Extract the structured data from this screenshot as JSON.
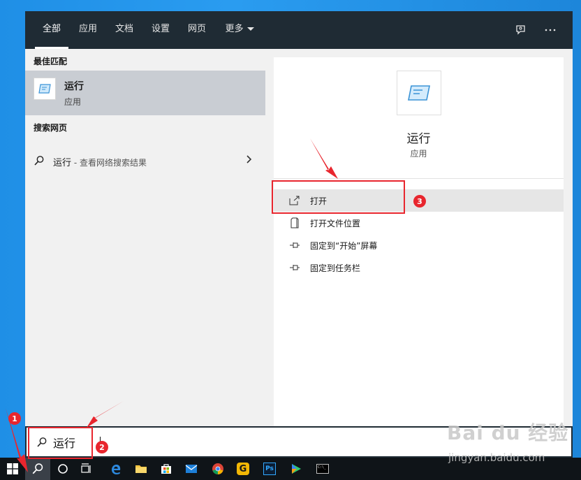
{
  "tabs": [
    {
      "label": "全部",
      "active": true
    },
    {
      "label": "应用"
    },
    {
      "label": "文档"
    },
    {
      "label": "设置"
    },
    {
      "label": "网页"
    },
    {
      "label": "更多"
    }
  ],
  "top_icons": [
    "feedback-icon",
    "more-icon"
  ],
  "left": {
    "best_match_title": "最佳匹配",
    "best_match": {
      "name": "运行",
      "type": "应用",
      "icon": "run-app-icon"
    },
    "web_title": "搜索网页",
    "web_result": {
      "query": "运行",
      "suffix": " - 查看网络搜索结果"
    }
  },
  "right": {
    "name": "运行",
    "type": "应用",
    "icon": "run-app-icon",
    "actions": [
      {
        "label": "打开",
        "icon": "open-icon"
      },
      {
        "label": "打开文件位置",
        "icon": "file-location-icon"
      },
      {
        "label": "固定到“开始”屏幕",
        "icon": "pin-icon"
      },
      {
        "label": "固定到任务栏",
        "icon": "pin-icon"
      }
    ]
  },
  "search": {
    "value": "运行",
    "icon": "search-icon"
  },
  "taskbar": {
    "items": [
      "windows-start-icon",
      "search-icon",
      "cortana-icon",
      "task-view-icon",
      "edge-icon",
      "file-explorer-icon",
      "store-icon",
      "mail-icon",
      "chrome-icon",
      "g-app-icon",
      "photoshop-icon",
      "media-player-icon",
      "cmd-icon"
    ],
    "ps_label": "Ps",
    "g_label": "G",
    "cmd_label": "C:\\_"
  },
  "annotations": {
    "badge1": "1",
    "badge2": "2",
    "badge3": "3"
  },
  "watermark": {
    "brand": "Bai du 经验",
    "url": "jingyan.baidu.com"
  },
  "colors": {
    "accent_red": "#e8262e",
    "topbar": "#1f2b34",
    "desktop": "#2597e8"
  }
}
